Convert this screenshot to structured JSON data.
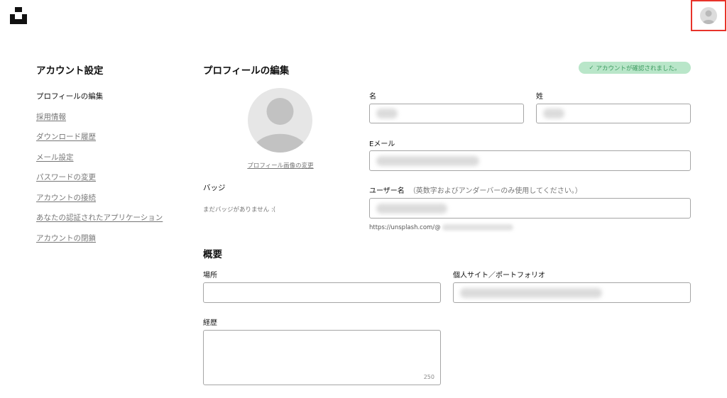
{
  "header": {
    "logo_icon": "unsplash-logo-icon",
    "avatar_icon": "user-avatar-icon"
  },
  "sidebar": {
    "title": "アカウント設定",
    "items": [
      {
        "label": "プロフィールの編集",
        "active": true
      },
      {
        "label": "採用情報"
      },
      {
        "label": "ダウンロード履歴"
      },
      {
        "label": "メール設定"
      },
      {
        "label": "パスワードの変更"
      },
      {
        "label": "アカウントの接続"
      },
      {
        "label": "あなたの認証されたアプリケーション"
      },
      {
        "label": "アカウントの閉鎖"
      }
    ]
  },
  "profile": {
    "title": "プロフィールの編集",
    "verified_badge": "アカウントが確認されました。",
    "change_picture": "プロフィール画像の変更",
    "badges_title": "バッジ",
    "badges_empty": "まだバッジがありません :("
  },
  "form": {
    "first_name_label": "名",
    "last_name_label": "姓",
    "email_label": "Eメール",
    "username_label": "ユーザー名",
    "username_hint": "（英数字およびアンダーバーのみ使用してください。）",
    "username_url_prefix": "https://unsplash.com/@"
  },
  "about": {
    "title": "概要",
    "location_label": "場所",
    "website_label": "個人サイト／ポートフォリオ",
    "bio_label": "経歴",
    "bio_counter": "250"
  },
  "colors": {
    "accent_red": "#e8332a",
    "verified_bg": "#b9e6c9",
    "verified_text": "#3b9b5f"
  }
}
